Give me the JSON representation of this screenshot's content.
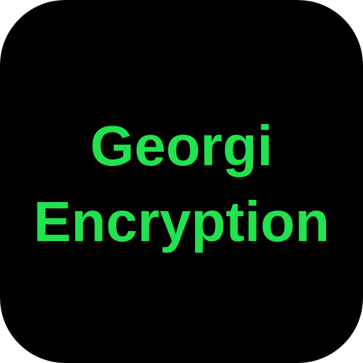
{
  "icon": {
    "background_color": "#000000",
    "text_color": "#22e34f",
    "line_1": "Georgi",
    "line_2": "Encryption"
  }
}
